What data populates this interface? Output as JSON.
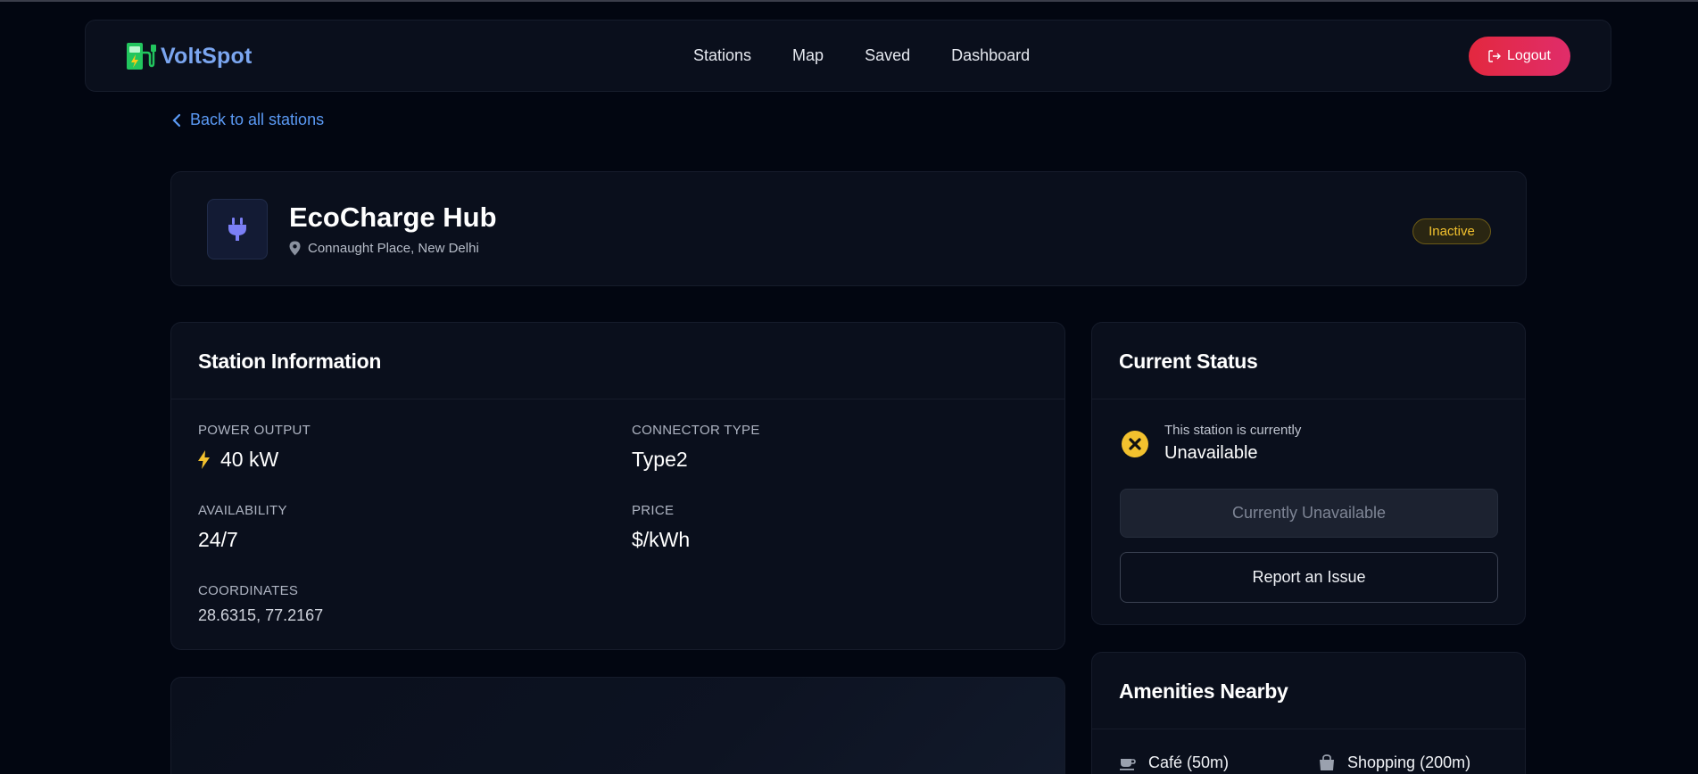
{
  "nav": {
    "brand": "VoltSpot",
    "links": [
      "Stations",
      "Map",
      "Saved",
      "Dashboard"
    ],
    "logout_label": "Logout"
  },
  "back_link": "Back to all stations",
  "station": {
    "name": "EcoCharge Hub",
    "location": "Connaught Place, New Delhi",
    "status_badge": "Inactive"
  },
  "info": {
    "title": "Station Information",
    "power_label": "POWER OUTPUT",
    "power_value": "40 kW",
    "connector_label": "CONNECTOR TYPE",
    "connector_value": "Type2",
    "availability_label": "AVAILABILITY",
    "availability_value": "24/7",
    "price_label": "PRICE",
    "price_value": "$/kWh",
    "coords_label": "COORDINATES",
    "coords_value": "28.6315, 77.2167"
  },
  "status": {
    "title": "Current Status",
    "subtitle": "This station is currently",
    "state": "Unavailable",
    "unavailable_button": "Currently Unavailable",
    "report_button": "Report an Issue"
  },
  "amenities": {
    "title": "Amenities Nearby",
    "items": [
      {
        "label": "Café (50m)",
        "icon": "coffee-icon"
      },
      {
        "label": "Shopping (200m)",
        "icon": "shopping-bag-icon"
      }
    ]
  },
  "colors": {
    "background": "#020611",
    "card": "#0a0f1c",
    "brand": "#7ba6f0",
    "link": "#5b9af5",
    "logout": "#e3283f",
    "inactive": "#f2c12e",
    "plug": "#7b7ff5"
  }
}
